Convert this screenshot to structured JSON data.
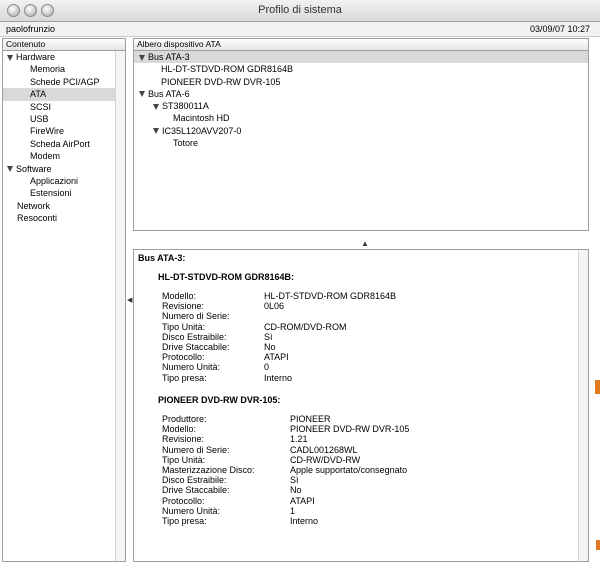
{
  "window": {
    "title": "Profilo di sistema"
  },
  "infobar": {
    "user": "paolofrunzio",
    "datetime": "03/09/07 10:27"
  },
  "sidebar": {
    "header": "Contenuto",
    "items": [
      {
        "label": "Hardware",
        "type": "group",
        "expanded": true
      },
      {
        "label": "Memoria",
        "type": "child"
      },
      {
        "label": "Schede PCI/AGP",
        "type": "child"
      },
      {
        "label": "ATA",
        "type": "child",
        "selected": true
      },
      {
        "label": "SCSI",
        "type": "child"
      },
      {
        "label": "USB",
        "type": "child"
      },
      {
        "label": "FireWire",
        "type": "child"
      },
      {
        "label": "Scheda AirPort",
        "type": "child"
      },
      {
        "label": "Modem",
        "type": "child"
      },
      {
        "label": "Software",
        "type": "group",
        "expanded": true
      },
      {
        "label": "Applicazioni",
        "type": "child"
      },
      {
        "label": "Estensioni",
        "type": "child"
      },
      {
        "label": "Network",
        "type": "top"
      },
      {
        "label": "Resoconti",
        "type": "top"
      }
    ]
  },
  "tree": {
    "header": "Albero dispositivo ATA",
    "items": [
      {
        "label": "Bus ATA-3",
        "level": 0,
        "expanded": true,
        "selected": true
      },
      {
        "label": "HL-DT-STDVD-ROM GDR8164B",
        "level": 1
      },
      {
        "label": "PIONEER DVD-RW  DVR-105",
        "level": 1
      },
      {
        "label": "Bus ATA-6",
        "level": 0,
        "expanded": true
      },
      {
        "label": "ST380011A",
        "level": 1,
        "expanded": true
      },
      {
        "label": "Macintosh HD",
        "level": 2
      },
      {
        "label": "IC35L120AVV207-0",
        "level": 1,
        "expanded": true
      },
      {
        "label": "Totore",
        "level": 2
      }
    ]
  },
  "detail": {
    "title": "Bus ATA-3:",
    "devices": [
      {
        "name": "HL-DT-STDVD-ROM GDR8164B:",
        "rows": [
          {
            "key": "Modello:",
            "value": "HL-DT-STDVD-ROM GDR8164B"
          },
          {
            "key": "Revisione:",
            "value": "0L06"
          },
          {
            "key": "Numero di Serie:",
            "value": ""
          },
          {
            "key": "Tipo Unità:",
            "value": "CD-ROM/DVD-ROM"
          },
          {
            "key": "Disco Estraibile:",
            "value": "Sì"
          },
          {
            "key": "Drive Staccabile:",
            "value": "No"
          },
          {
            "key": "Protocollo:",
            "value": "ATAPI"
          },
          {
            "key": "Numero Unità:",
            "value": "0"
          },
          {
            "key": "Tipo presa:",
            "value": "Interno"
          }
        ]
      },
      {
        "name": "PIONEER DVD-RW  DVR-105:",
        "rows": [
          {
            "key": "Produttore:",
            "value": "PIONEER"
          },
          {
            "key": "Modello:",
            "value": "PIONEER DVD-RW  DVR-105"
          },
          {
            "key": "Revisione:",
            "value": "1.21"
          },
          {
            "key": "Numero di Serie:",
            "value": "CADL001268WL"
          },
          {
            "key": "Tipo Unità:",
            "value": "CD-RW/DVD-RW"
          },
          {
            "key": "Masterizzazione Disco:",
            "value": "Apple supportato/consegnato"
          },
          {
            "key": "Disco Estraibile:",
            "value": "Sì"
          },
          {
            "key": "Drive Staccabile:",
            "value": "No"
          },
          {
            "key": "Protocollo:",
            "value": "ATAPI"
          },
          {
            "key": "Numero Unità:",
            "value": "1"
          },
          {
            "key": "Tipo presa:",
            "value": "Interno"
          }
        ]
      }
    ]
  },
  "icons": {
    "close": "close-button-icon",
    "minimize": "minimize-button-icon",
    "zoom": "zoom-button-icon",
    "disclosure": "disclosure-triangle-icon"
  },
  "colors": {
    "selection": "#d9d9d9",
    "accent": "#e07a20"
  }
}
